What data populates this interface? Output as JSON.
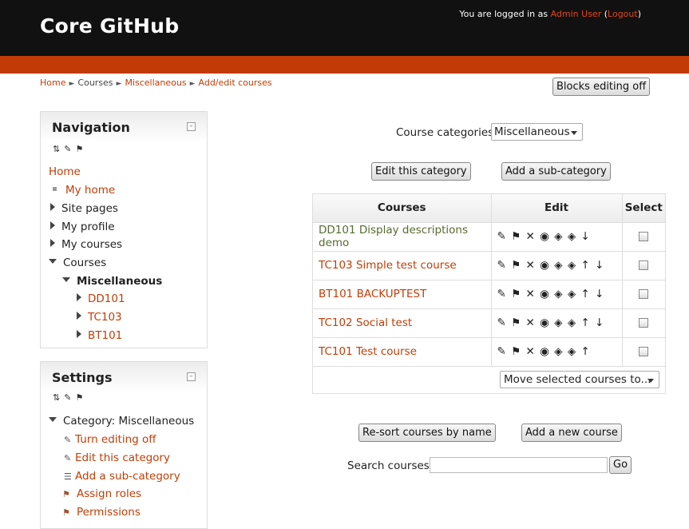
{
  "header": {
    "site_title": "Core GitHub",
    "login_prefix": "You are logged in as ",
    "user_name": "Admin User",
    "logout_open": " (",
    "logout_label": "Logout",
    "logout_close": ")"
  },
  "breadcrumb": {
    "items": [
      "Home",
      "Courses",
      "Miscellaneous",
      "Add/edit courses"
    ],
    "separator": "►"
  },
  "blocks_editing_button": "Blocks editing off",
  "navigation": {
    "title": "Navigation",
    "collapse": "–",
    "home": "Home",
    "items": [
      "My home",
      "Site pages",
      "My profile",
      "My courses",
      "Courses"
    ],
    "subcategory": "Miscellaneous",
    "courses": [
      "DD101",
      "TC103",
      "BT101"
    ]
  },
  "settings": {
    "title": "Settings",
    "collapse": "–",
    "category": "Category: Miscellaneous",
    "items": [
      "Turn editing off",
      "Edit this category",
      "Add a sub-category",
      "Assign roles",
      "Permissions"
    ]
  },
  "category_select": {
    "label": "Course categories:",
    "value": "Miscellaneous"
  },
  "buttons": {
    "edit_category": "Edit this category",
    "add_subcategory": "Add a sub-category",
    "resort": "Re-sort courses by name",
    "add_course": "Add a new course",
    "go": "Go"
  },
  "table": {
    "headers": [
      "Courses",
      "Edit",
      "Select"
    ],
    "rows": [
      {
        "name": "DD101 Display descriptions demo",
        "dimmed": true,
        "icons": "✎ ⚑ ✕ ◉ ◈ ◈ ↓"
      },
      {
        "name": "TC103 Simple test course",
        "dimmed": false,
        "icons": "✎ ⚑ ✕ ◉ ◈ ◈ ↑ ↓"
      },
      {
        "name": "BT101 BACKUPTEST",
        "dimmed": false,
        "icons": "✎ ⚑ ✕ ◉ ◈ ◈ ↑ ↓"
      },
      {
        "name": "TC102 Social test",
        "dimmed": false,
        "icons": "✎ ⚑ ✕ ◉ ◈ ◈ ↑ ↓"
      },
      {
        "name": "TC101 Test course",
        "dimmed": false,
        "icons": "✎ ⚑ ✕ ◉ ◈ ◈ ↑"
      }
    ],
    "move_select": "Move selected courses to..."
  },
  "search": {
    "label": "Search courses:",
    "value": ""
  },
  "colors": {
    "header_bg": "#111111",
    "accent_bar": "#c23a05",
    "link": "#c23d06",
    "dimmed_link": "#556b2f"
  },
  "icons": {
    "block_tools": [
      "move-icon",
      "edit-icon",
      "roles-icon"
    ],
    "edit_row": [
      "edit-icon",
      "assign-roles-icon",
      "delete-icon",
      "hide-icon",
      "backup-icon",
      "restore-icon",
      "move-up-icon",
      "move-down-icon"
    ]
  }
}
